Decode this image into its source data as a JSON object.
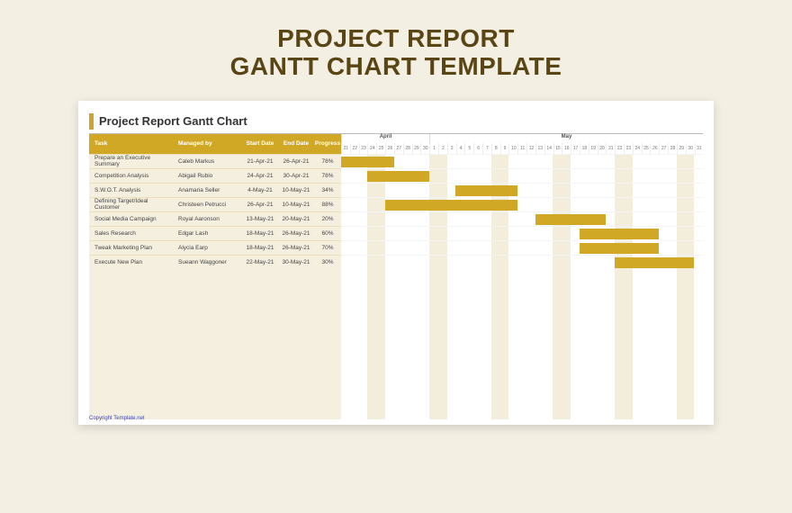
{
  "page": {
    "title_line1": "PROJECT REPORT",
    "title_line2": "GANTT CHART TEMPLATE"
  },
  "doc": {
    "title": "Project Report Gantt Chart",
    "copyright": "Copyright Template.net"
  },
  "columns": {
    "task": "Task",
    "managed_by": "Managed by",
    "start": "Start Date",
    "end": "End Date",
    "progress": "Progress"
  },
  "months": [
    "April",
    "May"
  ],
  "days": [
    "21",
    "22",
    "23",
    "24",
    "25",
    "26",
    "27",
    "28",
    "29",
    "30",
    "1",
    "2",
    "3",
    "4",
    "5",
    "6",
    "7",
    "8",
    "9",
    "10",
    "11",
    "12",
    "13",
    "14",
    "15",
    "16",
    "17",
    "18",
    "19",
    "20",
    "21",
    "22",
    "23",
    "24",
    "25",
    "26",
    "27",
    "28",
    "29",
    "30",
    "31"
  ],
  "weekend_cols": [
    3,
    4,
    10,
    11,
    17,
    18,
    24,
    25,
    31,
    32,
    38,
    39
  ],
  "rows": [
    {
      "task": "Prepare an Executive Summary",
      "mgr": "Caleb Markus",
      "start": "21-Apr-21",
      "end": "26-Apr-21",
      "prog": "78%",
      "bar_start": 0,
      "bar_span": 6
    },
    {
      "task": "Competition Analysis",
      "mgr": "Abigail Rubio",
      "start": "24-Apr-21",
      "end": "30-Apr-21",
      "prog": "78%",
      "bar_start": 3,
      "bar_span": 7
    },
    {
      "task": "S.W.O.T. Analysis",
      "mgr": "Anamaria Seller",
      "start": "4-May-21",
      "end": "10-May-21",
      "prog": "34%",
      "bar_start": 13,
      "bar_span": 7
    },
    {
      "task": "Defining Target/Ideal Customer",
      "mgr": "Christeen Petrucci",
      "start": "26-Apr-21",
      "end": "10-May-21",
      "prog": "88%",
      "bar_start": 5,
      "bar_span": 15
    },
    {
      "task": "Social Media Campaign",
      "mgr": "Royal Aaronson",
      "start": "13-May-21",
      "end": "20-May-21",
      "prog": "20%",
      "bar_start": 22,
      "bar_span": 8
    },
    {
      "task": "Sales Research",
      "mgr": "Edgar Lash",
      "start": "18-May-21",
      "end": "26-May-21",
      "prog": "60%",
      "bar_start": 27,
      "bar_span": 9
    },
    {
      "task": "Tweak Marketing Plan",
      "mgr": "Alycia Earp",
      "start": "18-May-21",
      "end": "26-May-21",
      "prog": "70%",
      "bar_start": 27,
      "bar_span": 9
    },
    {
      "task": "Execute New Plan",
      "mgr": "Sueann Waggoner",
      "start": "22-May-21",
      "end": "30-May-21",
      "prog": "30%",
      "bar_start": 31,
      "bar_span": 9
    }
  ],
  "chart_data": {
    "type": "bar",
    "title": "Project Report Gantt Chart",
    "xlabel": "Date",
    "ylabel": "Task",
    "x_range": [
      "2021-04-21",
      "2021-05-31"
    ],
    "series": [
      {
        "name": "Prepare an Executive Summary",
        "manager": "Caleb Markus",
        "start": "2021-04-21",
        "end": "2021-04-26",
        "progress_pct": 78
      },
      {
        "name": "Competition Analysis",
        "manager": "Abigail Rubio",
        "start": "2021-04-24",
        "end": "2021-04-30",
        "progress_pct": 78
      },
      {
        "name": "S.W.O.T. Analysis",
        "manager": "Anamaria Seller",
        "start": "2021-05-04",
        "end": "2021-05-10",
        "progress_pct": 34
      },
      {
        "name": "Defining Target/Ideal Customer",
        "manager": "Christeen Petrucci",
        "start": "2021-04-26",
        "end": "2021-05-10",
        "progress_pct": 88
      },
      {
        "name": "Social Media Campaign",
        "manager": "Royal Aaronson",
        "start": "2021-05-13",
        "end": "2021-05-20",
        "progress_pct": 20
      },
      {
        "name": "Sales Research",
        "manager": "Edgar Lash",
        "start": "2021-05-18",
        "end": "2021-05-26",
        "progress_pct": 60
      },
      {
        "name": "Tweak Marketing Plan",
        "manager": "Alycia Earp",
        "start": "2021-05-18",
        "end": "2021-05-26",
        "progress_pct": 70
      },
      {
        "name": "Execute New Plan",
        "manager": "Sueann Waggoner",
        "start": "2021-05-22",
        "end": "2021-05-30",
        "progress_pct": 30
      }
    ]
  }
}
